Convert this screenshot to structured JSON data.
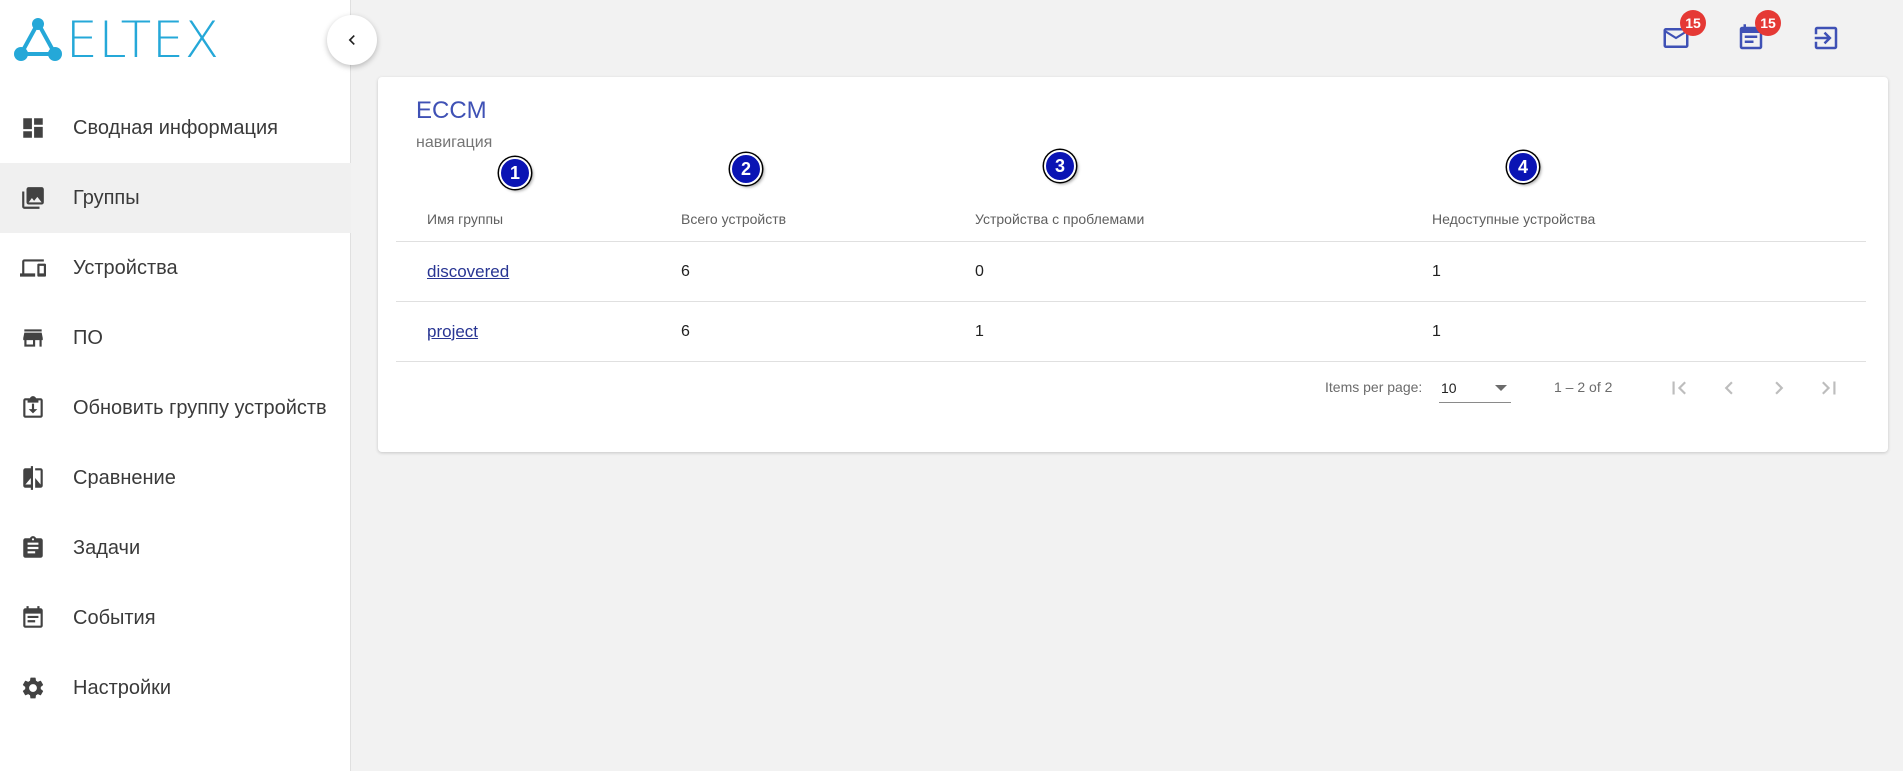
{
  "app": {
    "logo_text": "ELTEX",
    "brand_color": "#25a8d8",
    "accent_color": "#3f51b5"
  },
  "sidebar": {
    "collapse_icon": "chevron-left-icon",
    "items": [
      {
        "label": "Сводная информация",
        "icon": "dashboard-icon",
        "active": false
      },
      {
        "label": "Группы",
        "icon": "photo-library-icon",
        "active": true
      },
      {
        "label": "Устройства",
        "icon": "devices-icon",
        "active": false
      },
      {
        "label": "ПО",
        "icon": "store-icon",
        "active": false
      },
      {
        "label": "Обновить группу устройств",
        "icon": "download-box-icon",
        "active": false
      },
      {
        "label": "Сравнение",
        "icon": "compare-icon",
        "active": false
      },
      {
        "label": "Задачи",
        "icon": "clipboard-icon",
        "active": false
      },
      {
        "label": "События",
        "icon": "calendar-icon",
        "active": false
      },
      {
        "label": "Настройки",
        "icon": "gear-icon",
        "active": false
      }
    ]
  },
  "topbar": {
    "mail_badge": "15",
    "events_badge": "15",
    "badge_color": "#e53935"
  },
  "card": {
    "title": "ECCM",
    "subtitle": "навигация"
  },
  "table": {
    "columns": [
      "Имя группы",
      "Всего устройств",
      "Устройства с проблемами",
      "Недоступные устройства"
    ],
    "markers": [
      "1",
      "2",
      "3",
      "4"
    ],
    "rows": [
      {
        "name": "discovered",
        "total": "6",
        "problems": "0",
        "unavailable": "1"
      },
      {
        "name": "project",
        "total": "6",
        "problems": "1",
        "unavailable": "1"
      }
    ]
  },
  "paginator": {
    "items_per_page_label": "Items per page:",
    "page_size": "10",
    "range_label": "1 – 2 of 2"
  }
}
